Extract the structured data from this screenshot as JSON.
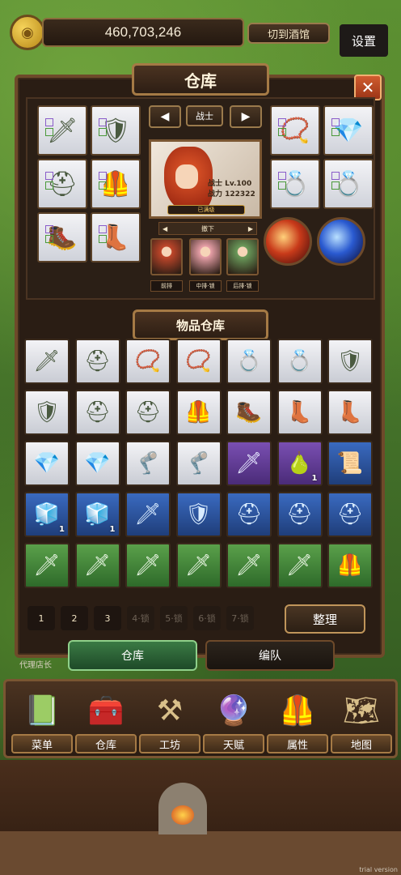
{
  "header": {
    "gold_amount": "460,703,246",
    "tavern_button": "切到酒馆",
    "settings_button": "设置"
  },
  "warehouse": {
    "title": "仓库",
    "close": "✕"
  },
  "hero": {
    "class_name": "战士",
    "level_text": "战士 Lv.100",
    "power_text": "战力 122322",
    "max_badge": "已满级",
    "position_label": "撤下",
    "team": [
      {
        "label": "前排",
        "color": "#c0462a"
      },
      {
        "label": "中排·锁",
        "color": "#e8a0a8"
      },
      {
        "label": "后排·锁",
        "color": "#6a9a5a"
      }
    ]
  },
  "equip_icons": {
    "left": [
      "🗡",
      "🛡",
      "⛑",
      "🦺",
      "🥾",
      "👢"
    ],
    "right": [
      "📿",
      "💎",
      "💍",
      "💍",
      "🎖",
      "🦿"
    ]
  },
  "inventory": {
    "title": "物品仓库",
    "rows": [
      [
        {
          "icon": "🗡",
          "rarity": "white"
        },
        {
          "icon": "⛑",
          "rarity": "white"
        },
        {
          "icon": "📿",
          "rarity": "white"
        },
        {
          "icon": "📿",
          "rarity": "white"
        },
        {
          "icon": "💍",
          "rarity": "white"
        },
        {
          "icon": "💍",
          "rarity": "white"
        },
        {
          "icon": "🛡",
          "rarity": "white"
        }
      ],
      [
        {
          "icon": "🛡",
          "rarity": "white"
        },
        {
          "icon": "⛑",
          "rarity": "white"
        },
        {
          "icon": "⛑",
          "rarity": "white"
        },
        {
          "icon": "🦺",
          "rarity": "white"
        },
        {
          "icon": "🥾",
          "rarity": "white"
        },
        {
          "icon": "👢",
          "rarity": "white"
        },
        {
          "icon": "👢",
          "rarity": "white"
        }
      ],
      [
        {
          "icon": "💎",
          "rarity": "white"
        },
        {
          "icon": "💎",
          "rarity": "white"
        },
        {
          "icon": "🦿",
          "rarity": "white"
        },
        {
          "icon": "🦿",
          "rarity": "white"
        },
        {
          "icon": "🗡",
          "rarity": "purple"
        },
        {
          "icon": "🍐",
          "rarity": "purple",
          "count": "1"
        },
        {
          "icon": "📜",
          "rarity": "blue"
        }
      ],
      [
        {
          "icon": "🧊",
          "rarity": "blue",
          "count": "1"
        },
        {
          "icon": "🧊",
          "rarity": "blue",
          "count": "1"
        },
        {
          "icon": "🗡",
          "rarity": "blue"
        },
        {
          "icon": "🛡",
          "rarity": "blue"
        },
        {
          "icon": "⛑",
          "rarity": "blue"
        },
        {
          "icon": "⛑",
          "rarity": "blue"
        },
        {
          "icon": "⛑",
          "rarity": "blue"
        }
      ],
      [
        {
          "icon": "🗡",
          "rarity": "green"
        },
        {
          "icon": "🗡",
          "rarity": "green"
        },
        {
          "icon": "🗡",
          "rarity": "green"
        },
        {
          "icon": "🗡",
          "rarity": "green"
        },
        {
          "icon": "🗡",
          "rarity": "green"
        },
        {
          "icon": "🗡",
          "rarity": "green"
        },
        {
          "icon": "🦺",
          "rarity": "green"
        }
      ]
    ]
  },
  "pagination": {
    "pages": [
      "1",
      "2",
      "3"
    ],
    "locked_pages": [
      "4·锁",
      "5·锁",
      "6·锁",
      "7·锁"
    ],
    "sort_button": "整理"
  },
  "tabs": {
    "warehouse": "仓库",
    "formation": "编队"
  },
  "agent_label": "代理店长",
  "menu": [
    {
      "label": "菜单",
      "icon": "📗"
    },
    {
      "label": "仓库",
      "icon": "🧰"
    },
    {
      "label": "工坊",
      "icon": "⚒"
    },
    {
      "label": "天赋",
      "icon": "🔮"
    },
    {
      "label": "属性",
      "icon": "🦺"
    },
    {
      "label": "地图",
      "icon": "🗺"
    }
  ],
  "footer": {
    "trial": "trial version"
  }
}
